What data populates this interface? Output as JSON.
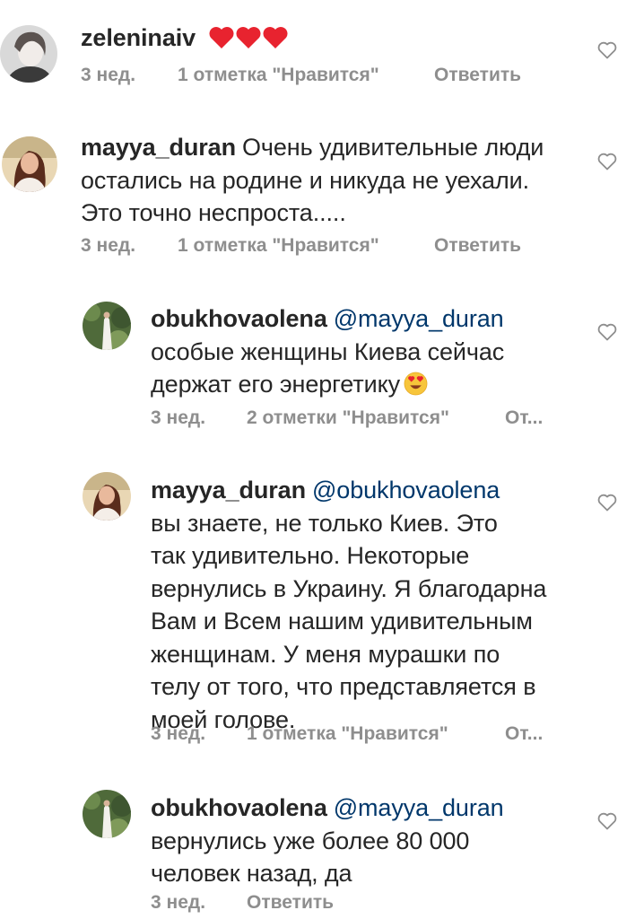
{
  "comments": [
    {
      "username": "zeleninaiv",
      "mention": "",
      "text": "",
      "emoji": "heart-red-icon",
      "time": "3 нед.",
      "likes": "1 отметка \"Нравится\"",
      "reply": "Ответить"
    },
    {
      "username": "mayya_duran",
      "mention": "",
      "text_lines": [
        "Очень удивительные люди",
        "остались на родине и никуда не уехали.",
        "Это точно неспроста....."
      ],
      "time": "3 нед.",
      "likes": "1 отметка \"Нравится\"",
      "reply": "Ответить"
    },
    {
      "username": "obukhovaolena",
      "mention": "@mayya_duran",
      "text_lines": [
        "особые женщины Киева сейчас",
        "держат его энергетику"
      ],
      "emoji": "heart-eyes-emoji",
      "time": "3 нед.",
      "likes": "2 отметки \"Нравится\"",
      "reply": "От..."
    },
    {
      "username": "mayya_duran",
      "mention": "@obukhovaolena",
      "text_lines": [
        "вы знаете, не только Киев. Это",
        "так удивительно. Некоторые",
        "вернулись в Украину. Я благодарна",
        "Вам и Всем нашим удивительным",
        "женщинам. У меня мурашки по",
        "телу от того, что представляется в",
        "моей голове."
      ],
      "time": "3 нед.",
      "likes": "1 отметка \"Нравится\"",
      "reply": "От..."
    },
    {
      "username": "obukhovaolena",
      "mention": "@mayya_duran",
      "text_lines": [
        "вернулись уже более 80 000",
        "человек назад, да"
      ],
      "time": "3 нед.",
      "reply": "Ответить"
    }
  ]
}
